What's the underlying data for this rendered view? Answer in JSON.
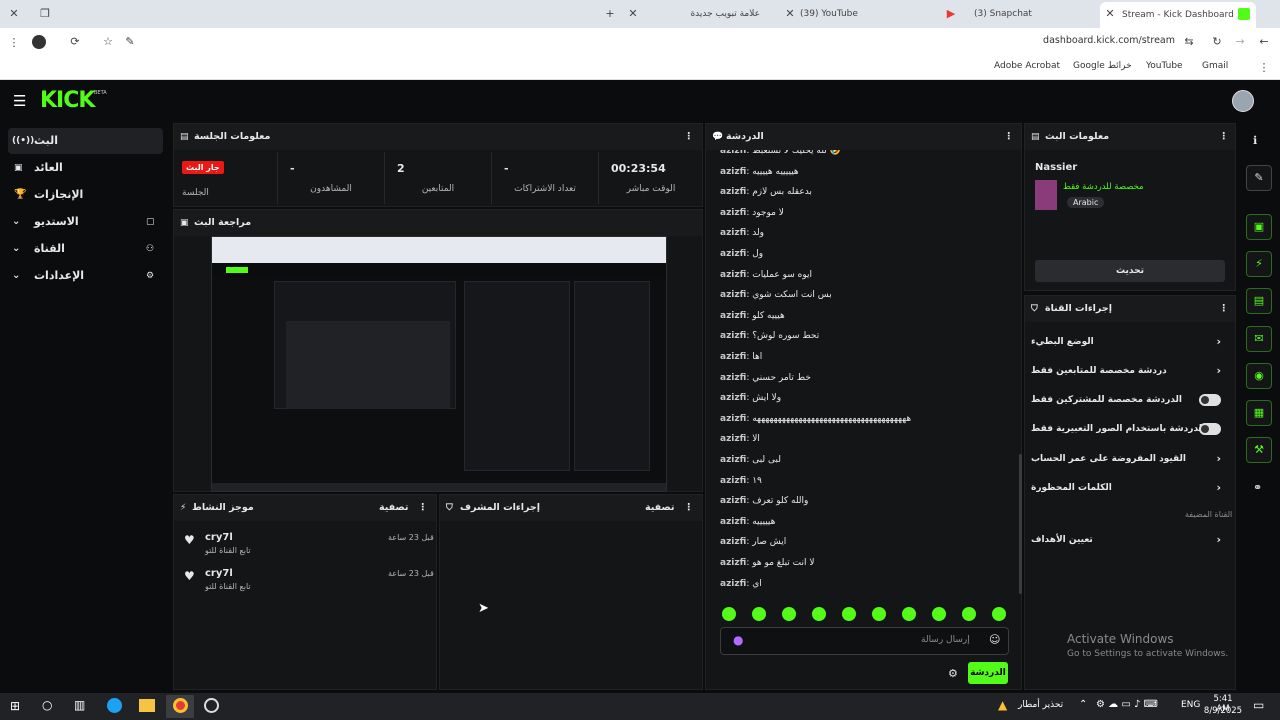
{
  "browser": {
    "tabs": [
      "علامة تبويب جديدة",
      "(39) YouTube",
      "(3) Snapchat",
      "Stream - Kick Dashboard"
    ],
    "url": "dashboard.kick.com/stream",
    "bookmarks": [
      "Adobe Acrobat",
      "Google خرائط",
      "YouTube",
      "Gmail"
    ]
  },
  "header": {
    "logo": "KICK",
    "beta": "BETA"
  },
  "sidebar": {
    "items": [
      {
        "label": "البث",
        "icon": "broadcast-icon"
      },
      {
        "label": "العائد",
        "icon": "revenue-icon"
      },
      {
        "label": "الإنجازات",
        "icon": "trophy-icon"
      },
      {
        "label": "الاستديو",
        "icon": "studio-icon"
      },
      {
        "label": "القناة",
        "icon": "channel-icon"
      },
      {
        "label": "الإعدادات",
        "icon": "settings-icon"
      }
    ]
  },
  "session": {
    "title": "معلومات الجلسة",
    "live_badge": "جار البث",
    "session_label": "الجلسة",
    "stats": [
      {
        "value": "-",
        "label": "المشاهدون"
      },
      {
        "value": "2",
        "label": "المتابعين"
      },
      {
        "value": "-",
        "label": "تعداد الاشتراكات"
      },
      {
        "value": "00:23:54",
        "label": "الوقت مباشر"
      }
    ]
  },
  "preview": {
    "title": "مراجعة البث"
  },
  "activity": {
    "title": "موجز النشاط",
    "filter": "تصفية",
    "items": [
      {
        "user": "cry7l",
        "action": "تابع القناة للتو",
        "time": "قبل 23 ساعة"
      },
      {
        "user": "cry7l",
        "action": "تابع القناة للتو",
        "time": "قبل 23 ساعة"
      }
    ]
  },
  "mod": {
    "title": "إجراءات المشرف",
    "filter": "تصفية"
  },
  "chat": {
    "title": "الدردشة",
    "messages": [
      {
        "user": "azizfi",
        "text": "لله يخليك لا تستعبط 🤣"
      },
      {
        "user": "azizfi",
        "text": "هيييييه هييييه"
      },
      {
        "user": "azizfi",
        "text": "بدعقله بس لازم"
      },
      {
        "user": "azizfi",
        "text": "لا موجود"
      },
      {
        "user": "azizfi",
        "text": "ولد"
      },
      {
        "user": "azizfi",
        "text": "ول"
      },
      {
        "user": "azizfi",
        "text": "ايوه سو عمليات"
      },
      {
        "user": "azizfi",
        "text": "بس انت اسكت شوي"
      },
      {
        "user": "azizfi",
        "text": "هيييه كلو"
      },
      {
        "user": "azizfi",
        "text": "تحط سوره لوش؟"
      },
      {
        "user": "azizfi",
        "text": "اها"
      },
      {
        "user": "azizfi",
        "text": "خط تامر حسني"
      },
      {
        "user": "azizfi",
        "text": "ولا ايش"
      },
      {
        "user": "azizfi",
        "text": "هههههههههههههههههههههههههههههههههههههه"
      },
      {
        "user": "azizfi",
        "text": "الا"
      },
      {
        "user": "azizfi",
        "text": "لبى لبى"
      },
      {
        "user": "azizfi",
        "text": "١٩"
      },
      {
        "user": "azizfi",
        "text": "والله كلو تعرف"
      },
      {
        "user": "azizfi",
        "text": "هيييييه"
      },
      {
        "user": "azizfi",
        "text": "ايش صار"
      },
      {
        "user": "azizfi",
        "text": "لا انت تبلغ مو هو"
      },
      {
        "user": "azizfi",
        "text": "اي"
      }
    ],
    "input_placeholder": "إرسال رسالة",
    "send_label": "الدردشة"
  },
  "stream_info": {
    "title": "معلومات البث",
    "streamer": "Nassier",
    "subtitle": "مخصصة للدردشة فقط",
    "language": "Arabic",
    "edit_label": "تحديث"
  },
  "channel_actions": {
    "title": "إجراءات القناة",
    "rows": [
      {
        "label": "الوضع البطيء",
        "kind": "chevron"
      },
      {
        "label": "دردشة مخصصة للمتابعين فقط",
        "kind": "chevron"
      },
      {
        "label": "الدردشة مخصصة للمشتركين فقط",
        "kind": "toggle"
      },
      {
        "label": "الدردشة باستخدام الصور التعبيرية فقط",
        "kind": "toggle"
      },
      {
        "label": "القيود المفروضة على عمر الحساب",
        "kind": "chevron"
      },
      {
        "label": "الكلمات المحظورة",
        "kind": "chevron"
      }
    ],
    "section_label": "القناة المضيفة",
    "goals_label": "تعيين الأهداف"
  },
  "watermark": {
    "line1": "Activate Windows",
    "line2": "Go to Settings to activate Windows."
  },
  "taskbar": {
    "weather": "تحذير أمطار",
    "lang": "ENG",
    "time": "5:41 AM",
    "date": "8/9/2025"
  },
  "colors": {
    "accent": "#53fc18",
    "live": "#e91916",
    "bg": "#0b0c0d",
    "panel": "#141517"
  }
}
